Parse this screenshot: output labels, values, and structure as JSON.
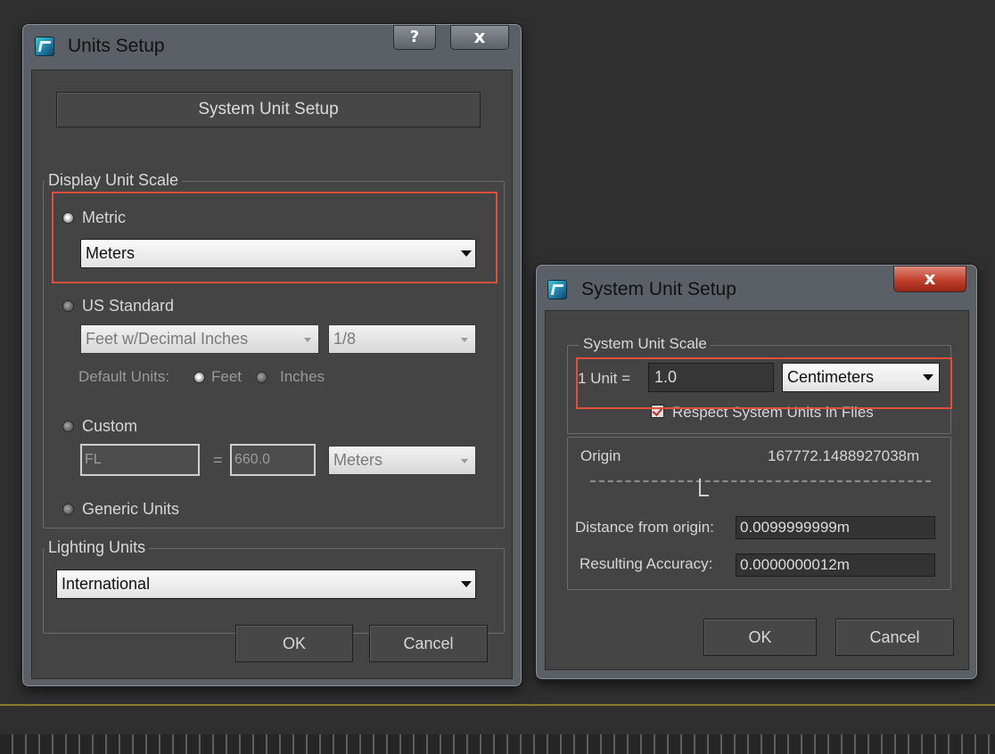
{
  "units_setup": {
    "title": "Units Setup",
    "help_button": "?",
    "close_button": "x",
    "system_unit_setup_button": "System Unit Setup",
    "display_unit_scale": {
      "label": "Display Unit Scale",
      "metric": {
        "label": "Metric",
        "selected": true,
        "dropdown_value": "Meters"
      },
      "us_standard": {
        "label": "US Standard",
        "dropdown_value": "Feet w/Decimal Inches",
        "fraction_value": "1/8",
        "default_units_label": "Default Units:",
        "feet_label": "Feet",
        "inches_label": "Inches"
      },
      "custom": {
        "label": "Custom",
        "name_value": "FL",
        "equals": "=",
        "value": "660.0",
        "unit_value": "Meters"
      },
      "generic": {
        "label": "Generic Units"
      }
    },
    "lighting_units": {
      "label": "Lighting Units",
      "dropdown_value": "International"
    },
    "ok_label": "OK",
    "cancel_label": "Cancel"
  },
  "system_unit_setup": {
    "title": "System Unit Setup",
    "close_button": "x",
    "system_unit_scale": {
      "label": "System Unit Scale",
      "unit_prefix": "1 Unit =",
      "unit_value": "1.0",
      "unit_type": "Centimeters",
      "respect_label": "Respect System Units in Files"
    },
    "origin": {
      "label": "Origin",
      "value": "167772.1488927038m",
      "distance_label": "Distance from origin:",
      "distance_value": "0.0099999999m",
      "accuracy_label": "Resulting Accuracy:",
      "accuracy_value": "0.0000000012m"
    },
    "ok_label": "OK",
    "cancel_label": "Cancel"
  },
  "colors": {
    "highlight": "#e0503c",
    "panel": "#444444",
    "background": "#2f2f2f"
  }
}
